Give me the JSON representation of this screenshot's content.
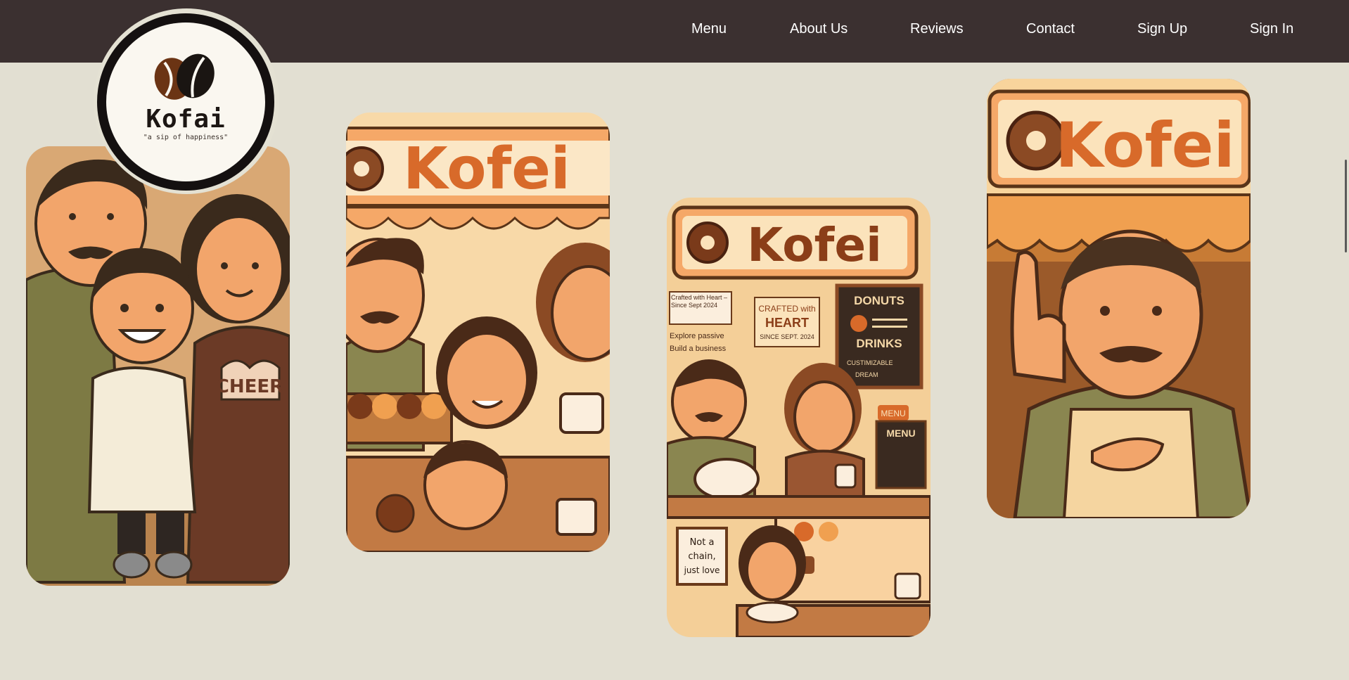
{
  "nav": {
    "items": [
      {
        "label": "Menu"
      },
      {
        "label": "About Us"
      },
      {
        "label": "Reviews"
      },
      {
        "label": "Contact"
      },
      {
        "label": "Sign Up"
      },
      {
        "label": "Sign In"
      }
    ]
  },
  "logo": {
    "name": "Kofai",
    "tagline": "\"a sip of happiness\""
  },
  "cards": [
    {
      "sign": "",
      "badge": "CHEER"
    },
    {
      "sign": "Kofei"
    },
    {
      "sign": "Kofei",
      "note": "Crafted with Heart – Since Sept 2024",
      "checklist": [
        "Explore passive",
        "Build a business"
      ],
      "poster_line1": "CRAFTED with",
      "poster_line2": "HEART",
      "poster_line3": "SINCE SEPT. 2024",
      "board_title1": "DONUTS",
      "board_title2": "DRINKS",
      "board_item1": "CUSTIMIZABLE",
      "board_item2": "DREAM",
      "menu_label": "MENU",
      "small_menu_title": "MENU",
      "chalk_line1": "Not a",
      "chalk_line2": "chain,",
      "chalk_line3": "just love"
    },
    {
      "sign": "Kofei"
    }
  ],
  "colors": {
    "nav_bg": "#3b3030",
    "page_bg": "#e2dfd2",
    "brand_orange": "#d86a2a"
  }
}
